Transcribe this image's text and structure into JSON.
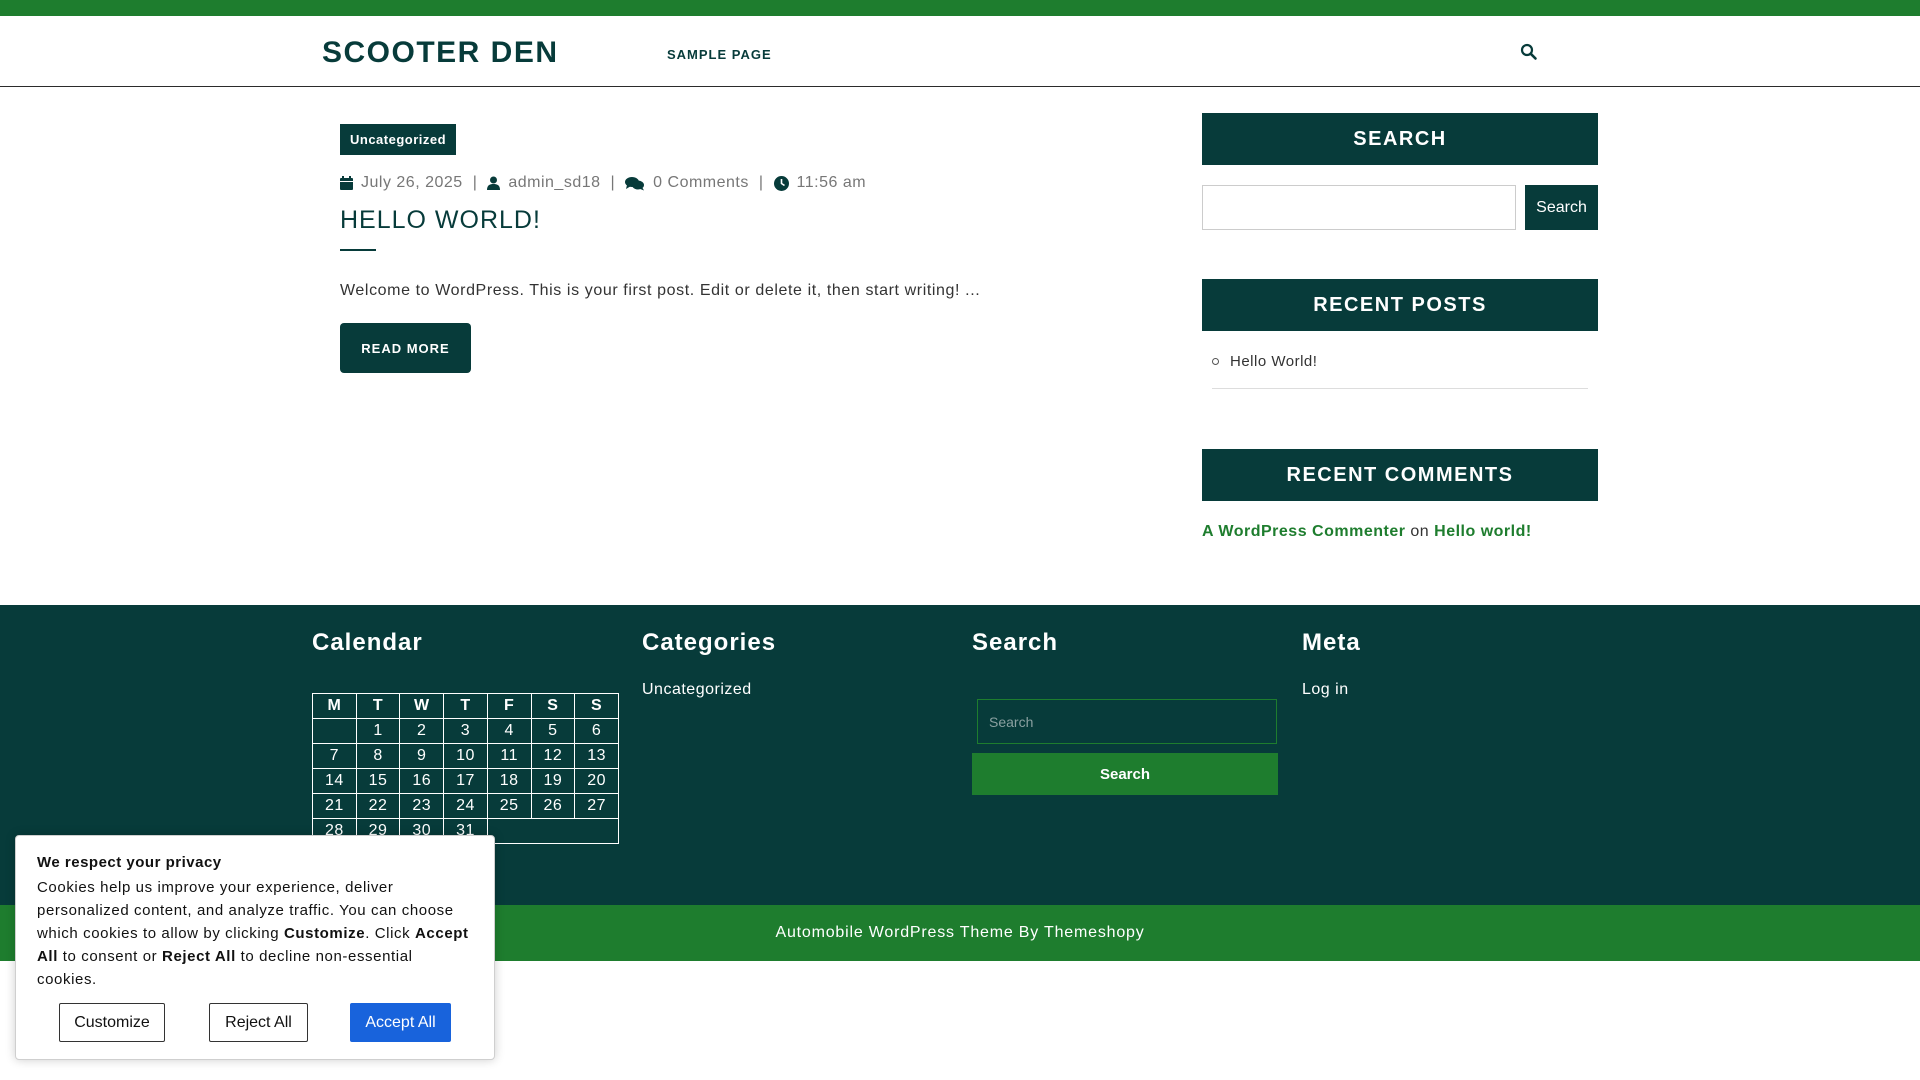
{
  "header": {
    "site_title": "SCOOTER DEN",
    "nav": [
      {
        "label": "SAMPLE PAGE"
      }
    ],
    "search_icon": "search-icon"
  },
  "post": {
    "category": "Uncategorized",
    "date": "July 26, 2025",
    "author": "admin_sd18",
    "comments": "0 Comments",
    "time": "11:56 am",
    "separator": "|",
    "title": "HELLO WORLD!",
    "excerpt": "Welcome to WordPress. This is your first post. Edit or delete it, then start writing! ...",
    "read_more": "READ MORE"
  },
  "sidebar": {
    "search_title": "SEARCH",
    "search_button": "Search",
    "recent_posts_title": "RECENT POSTS",
    "recent_posts": [
      "Hello World!"
    ],
    "recent_comments_title": "RECENT COMMENTS",
    "comment": {
      "author": "A WordPress Commenter",
      "on": "on",
      "post": "Hello world!"
    }
  },
  "footer": {
    "calendar": {
      "title": "Calendar",
      "days": [
        "M",
        "T",
        "W",
        "T",
        "F",
        "S",
        "S"
      ],
      "weeks": [
        [
          "",
          "1",
          "2",
          "3",
          "4",
          "5",
          "6"
        ],
        [
          "7",
          "8",
          "9",
          "10",
          "11",
          "12",
          "13"
        ],
        [
          "14",
          "15",
          "16",
          "17",
          "18",
          "19",
          "20"
        ],
        [
          "21",
          "22",
          "23",
          "24",
          "25",
          "26",
          "27"
        ],
        [
          "28",
          "29",
          "30",
          "31"
        ]
      ]
    },
    "categories": {
      "title": "Categories",
      "items": [
        "Uncategorized"
      ]
    },
    "search": {
      "title": "Search",
      "placeholder": "Search",
      "button": "Search"
    },
    "meta": {
      "title": "Meta",
      "items": [
        "Log in"
      ]
    },
    "copyright": "Automobile WordPress Theme By Themeshopy"
  },
  "cookie": {
    "title": "We respect your privacy",
    "text_1": "Cookies help us improve your experience, deliver personalized content, and analyze traffic. You can choose which cookies to allow by clicking ",
    "customize_word": "Customize",
    "text_2": ". Click ",
    "accept_word": "Accept All",
    "text_3": " to consent or ",
    "reject_word": "Reject All",
    "text_4": " to decline non-essential cookies.",
    "customize_button": "Customize",
    "reject_button": "Reject All",
    "accept_button": "Accept All"
  },
  "colors": {
    "primary": "#073b3a",
    "accent": "#1e7d2e",
    "cookie_accept": "#1863dc"
  }
}
